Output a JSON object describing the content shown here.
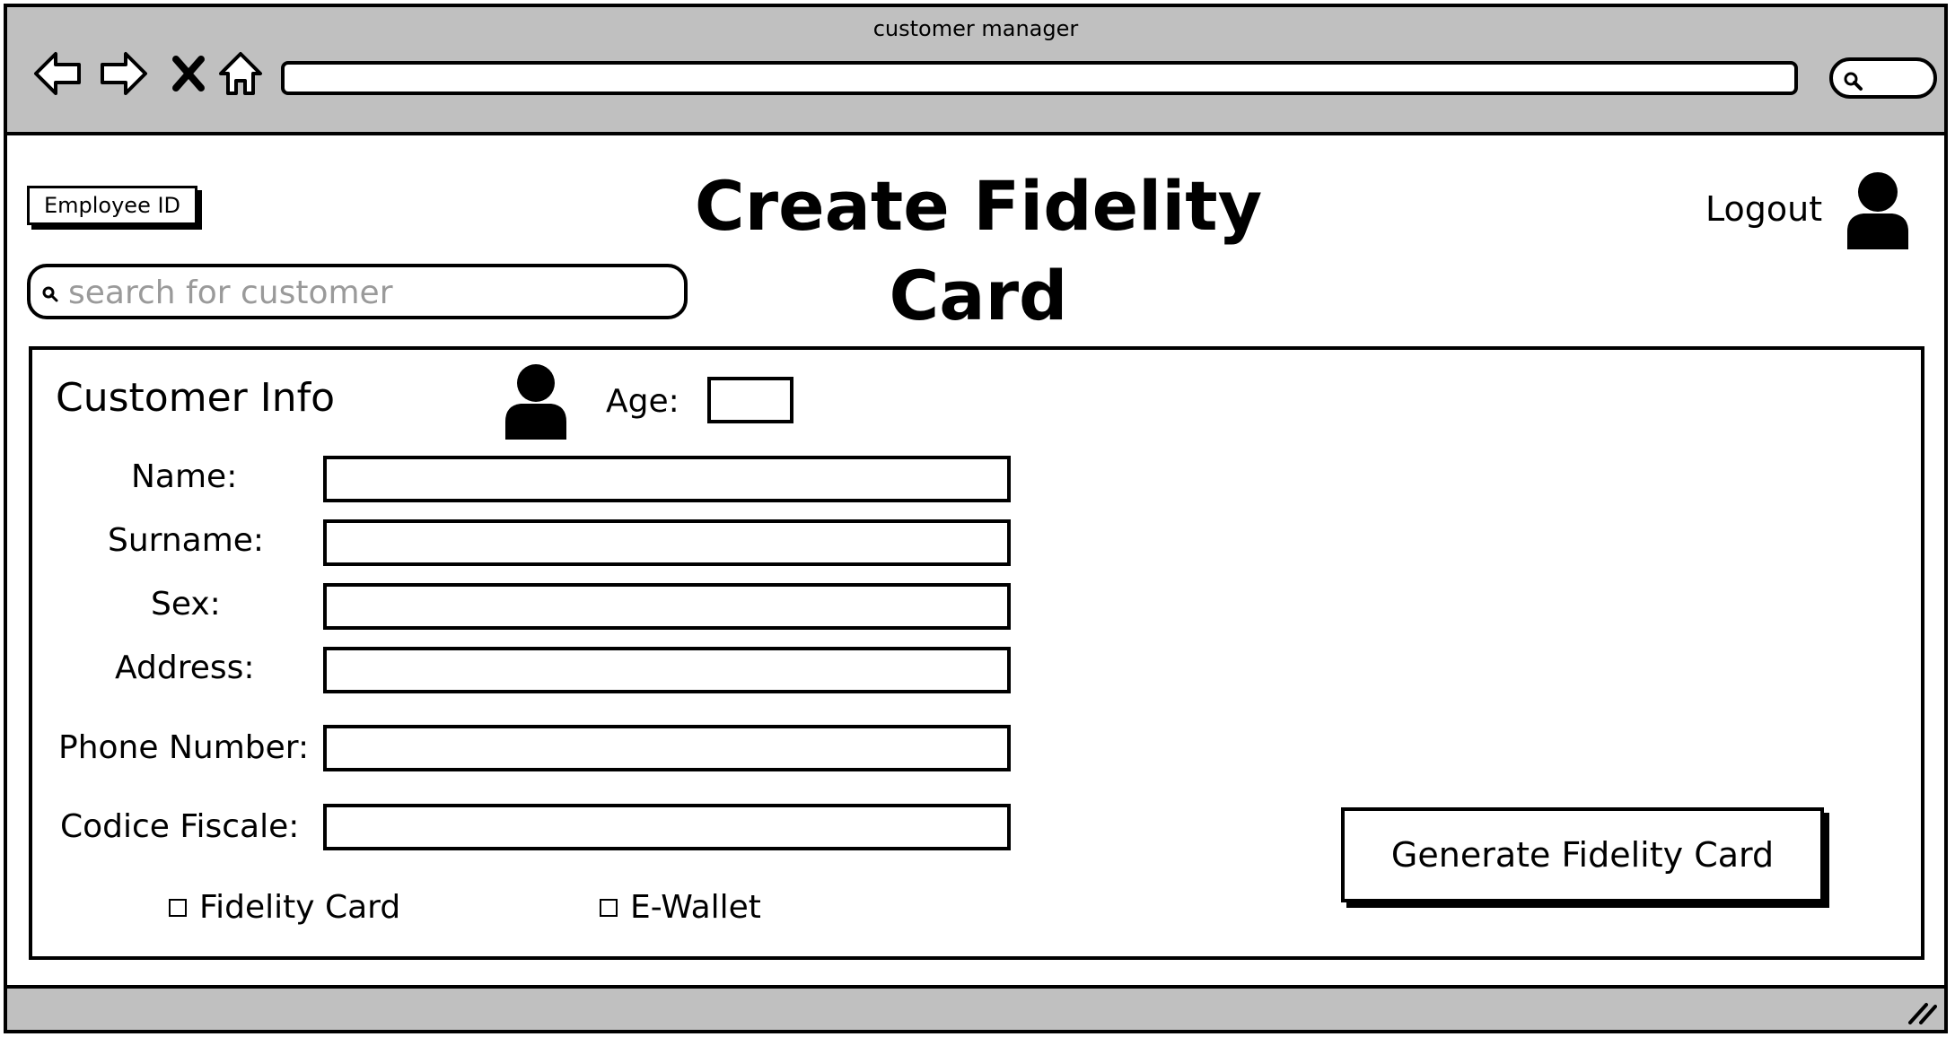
{
  "window": {
    "title": "customer manager"
  },
  "header": {
    "employee_id_label": "Employee ID",
    "page_title": "Create Fidelity Card",
    "logout_label": "Logout"
  },
  "search": {
    "placeholder": "search for customer"
  },
  "customer_info": {
    "title": "Customer Info",
    "age_label": "Age:",
    "fields": {
      "name_label": "Name:",
      "surname_label": "Surname:",
      "sex_label": "Sex:",
      "address_label": "Address:",
      "phone_label": "Phone Number:",
      "codice_fiscale_label": "Codice Fiscale:"
    },
    "options": {
      "fidelity_card_label": "Fidelity Card",
      "ewallet_label": "E-Wallet"
    },
    "generate_button_label": "Generate Fidelity Card"
  },
  "icons": {
    "back": "back-arrow-icon",
    "forward": "forward-arrow-icon",
    "close": "close-icon",
    "home": "home-icon",
    "search": "search-icon",
    "user": "user-avatar-icon",
    "resize": "resize-grip-icon"
  }
}
